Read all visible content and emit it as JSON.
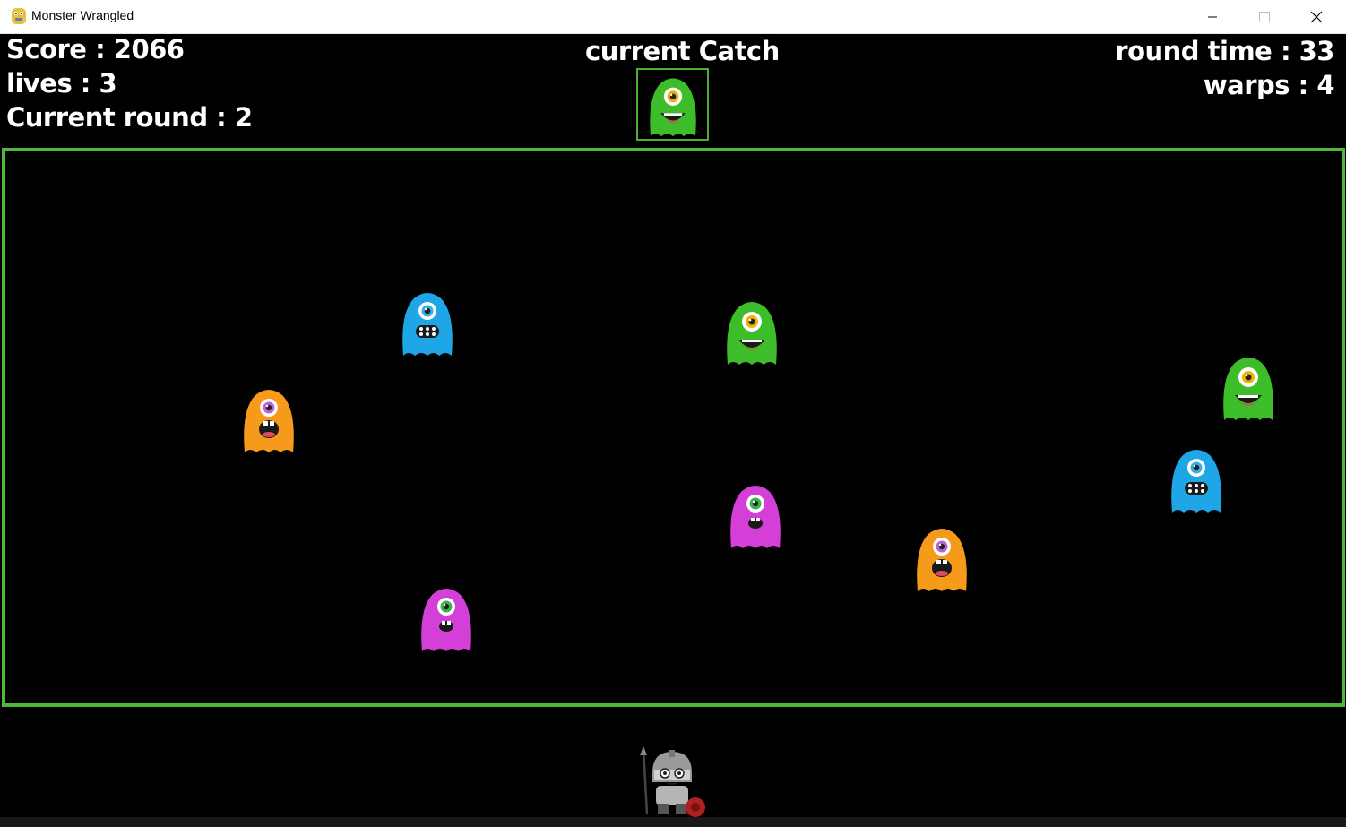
{
  "window": {
    "title": "Monster Wrangled",
    "icon": "python-icon",
    "controls": [
      "minimize",
      "maximize",
      "close"
    ]
  },
  "hud": {
    "score": "Score : 2066",
    "lives": "lives : 3",
    "round": "Current round : 2",
    "catch_label": "current Catch",
    "round_time": "round time : 33",
    "warps": "warps : 4"
  },
  "target_monster": "green-monster",
  "monsters": [
    {
      "color": "blue",
      "fur": "#1fa6e6",
      "eye": "#2fb0e8"
    },
    {
      "color": "green",
      "fur": "#3dbd2a",
      "eye": "#f0b400"
    },
    {
      "color": "green",
      "fur": "#3dbd2a",
      "eye": "#f0b400"
    },
    {
      "color": "orange",
      "fur": "#f59a1a",
      "eye": "#c160d0"
    },
    {
      "color": "blue",
      "fur": "#1fa6e6",
      "eye": "#2fb0e8"
    },
    {
      "color": "purple",
      "fur": "#d43fd8",
      "eye": "#3fb04a"
    },
    {
      "color": "orange",
      "fur": "#f59a1a",
      "eye": "#c160d0"
    },
    {
      "color": "purple",
      "fur": "#d43fd8",
      "eye": "#3fb04a"
    }
  ],
  "player": "knight",
  "colors": {
    "background": "#000000",
    "border": "#4fb83a",
    "text": "#ffffff"
  }
}
